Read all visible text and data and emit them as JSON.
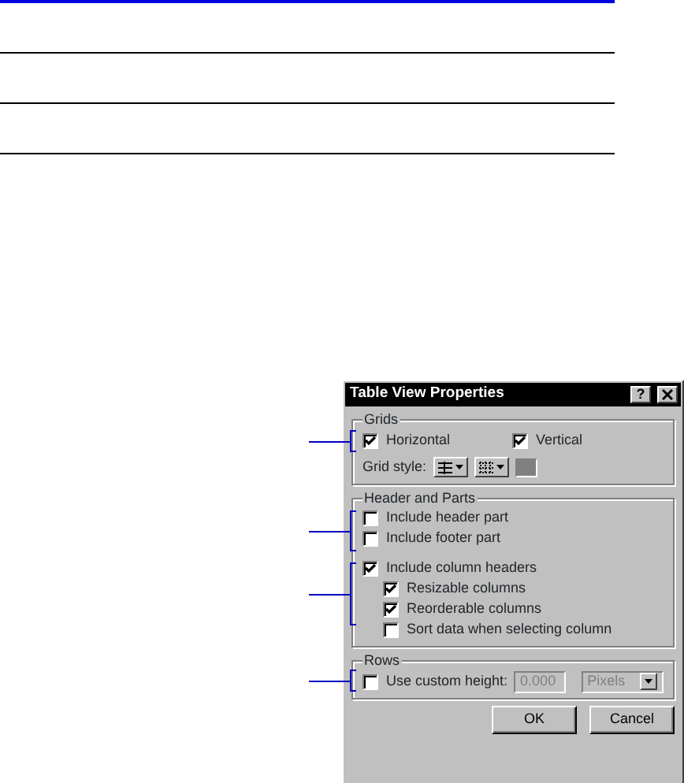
{
  "dialog": {
    "title": "Table View Properties",
    "help_button": "?",
    "grids": {
      "title": "Grids",
      "checkboxes": [
        {
          "label": "Horizontal",
          "checked": true
        },
        {
          "label": "Vertical",
          "checked": true
        }
      ],
      "grid_style_label": "Grid style:"
    },
    "header_and_parts": {
      "title": "Header and Parts",
      "items": [
        {
          "label": "Include header part",
          "checked": false
        },
        {
          "label": "Include footer part",
          "checked": false
        },
        {
          "label": "Include column headers",
          "checked": true,
          "children": [
            {
              "label": "Resizable columns",
              "checked": true
            },
            {
              "label": "Reorderable columns",
              "checked": true
            },
            {
              "label": "Sort data when selecting column",
              "checked": false
            }
          ]
        }
      ]
    },
    "rows": {
      "title": "Rows",
      "checkbox": {
        "label": "Use custom height:",
        "checked": false
      },
      "height_field": {
        "value": "0.000",
        "disabled": true
      },
      "unit_dropdown": {
        "value": "Pixels",
        "disabled": true
      }
    },
    "buttons": [
      "OK",
      "Cancel"
    ]
  }
}
